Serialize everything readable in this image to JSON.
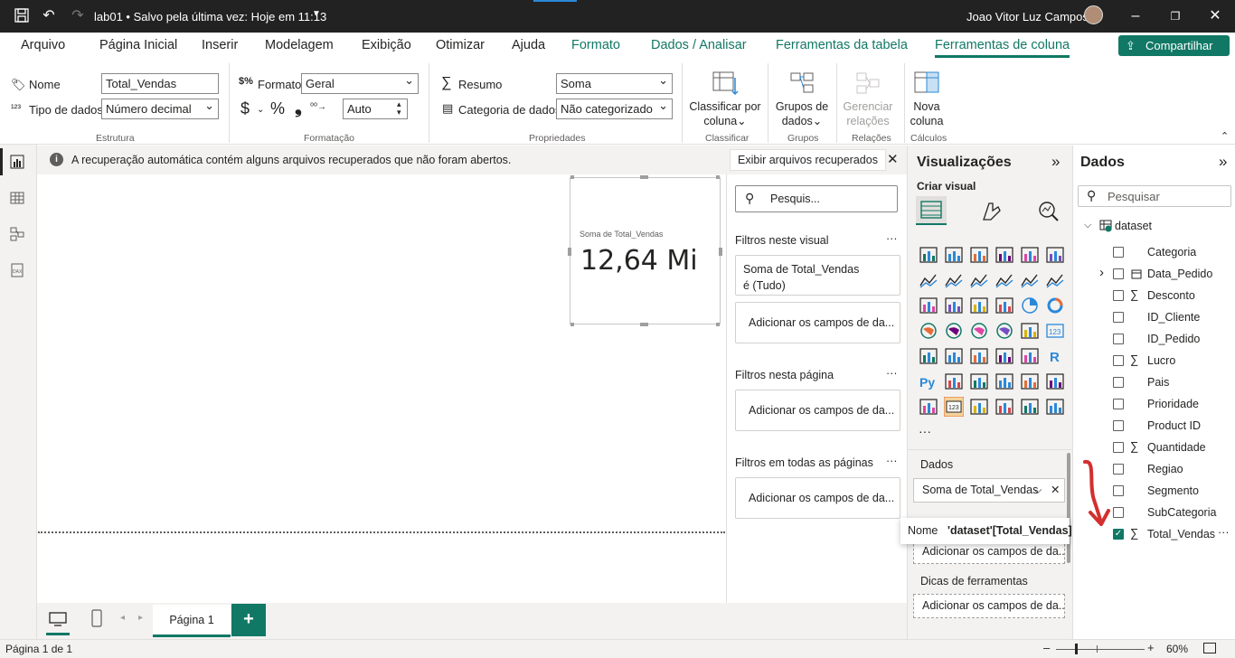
{
  "titlebar": {
    "title": "lab01 • Salvo pela última vez: Hoje em 11:13",
    "user": "Joao Vitor Luz Campos"
  },
  "tabs": [
    "Arquivo",
    "Página Inicial",
    "Inserir",
    "Modelagem",
    "Exibição",
    "Otimizar",
    "Ajuda",
    "Formato",
    "Dados / Analisar",
    "Ferramentas da tabela",
    "Ferramentas de coluna"
  ],
  "share_label": "Compartilhar",
  "ribbon": {
    "nome_label": "Nome",
    "nome_value": "Total_Vendas",
    "tipo_label": "Tipo de dados",
    "tipo_value": "Número decimal",
    "estrutura": "Estrutura",
    "formato_label": "Formato",
    "formato_value": "Geral",
    "currency": "$",
    "percent": "%",
    "comma": "❟",
    "decimals_value": "Auto",
    "formatacao": "Formatação",
    "resumo_label": "Resumo",
    "resumo_value": "Soma",
    "categoria_label": "Categoria de dados",
    "categoria_value": "Não categorizado",
    "propriedades": "Propriedades",
    "classificar_btn_1": "Classificar por",
    "classificar_btn_2": "coluna",
    "classificar": "Classificar",
    "grupos_btn_1": "Grupos de",
    "grupos_btn_2": "dados",
    "grupos": "Grupos",
    "gerenciar_btn_1": "Gerenciar",
    "gerenciar_btn_2": "relações",
    "relacoes": "Relações",
    "nova_btn_1": "Nova",
    "nova_btn_2": "coluna",
    "calculos": "Cálculos"
  },
  "infobar": {
    "message": "A recuperação automática contém alguns arquivos recuperados que não foram abertos.",
    "button": "Exibir arquivos recuperados"
  },
  "card": {
    "label": "Soma de Total_Vendas",
    "value": "12,64 Mi"
  },
  "filters": {
    "search_placeholder": "Pesquis...",
    "visual_head": "Filtros neste visual",
    "visual_filter_line1": "Soma de Total_Vendas",
    "visual_filter_line2": "é (Tudo)",
    "add_fields": "Adicionar os campos de da...",
    "page_head": "Filtros nesta página",
    "all_head": "Filtros em todas as páginas",
    "more": "···"
  },
  "viz": {
    "title": "Visualizações",
    "create": "Criar visual",
    "dados_head": "Dados",
    "dados_well": "Soma de Total_Vendas",
    "add_fields": "Adicionar os campos de da...",
    "dicas_head": "Dicas de ferramentas",
    "more": "···"
  },
  "tooltip": {
    "name_label": "Nome",
    "name_value": "'dataset'[Total_Vendas]"
  },
  "data": {
    "title": "Dados",
    "search_placeholder": "Pesquisar",
    "table": "dataset",
    "fields": [
      {
        "name": "Categoria",
        "sigma": false,
        "checked": false
      },
      {
        "name": "Data_Pedido",
        "sigma": false,
        "checked": false
      },
      {
        "name": "Desconto",
        "sigma": true,
        "checked": false
      },
      {
        "name": "ID_Cliente",
        "sigma": false,
        "checked": false
      },
      {
        "name": "ID_Pedido",
        "sigma": false,
        "checked": false
      },
      {
        "name": "Lucro",
        "sigma": true,
        "checked": false
      },
      {
        "name": "Pais",
        "sigma": false,
        "checked": false
      },
      {
        "name": "Prioridade",
        "sigma": false,
        "checked": false
      },
      {
        "name": "Product ID",
        "sigma": false,
        "checked": false
      },
      {
        "name": "Quantidade",
        "sigma": true,
        "checked": false
      },
      {
        "name": "Regiao",
        "sigma": false,
        "checked": false
      },
      {
        "name": "Segmento",
        "sigma": false,
        "checked": false
      },
      {
        "name": "SubCategoria",
        "sigma": false,
        "checked": false
      },
      {
        "name": "Total_Vendas",
        "sigma": true,
        "checked": true
      }
    ],
    "more": "···"
  },
  "pagebar": {
    "page_tab": "Página 1",
    "add": "+"
  },
  "status": {
    "page": "Página 1 de 1",
    "zoom": "60%"
  },
  "colors": {
    "accent": "#117865",
    "titlebar": "#222222",
    "annotation": "#d32f2f"
  }
}
